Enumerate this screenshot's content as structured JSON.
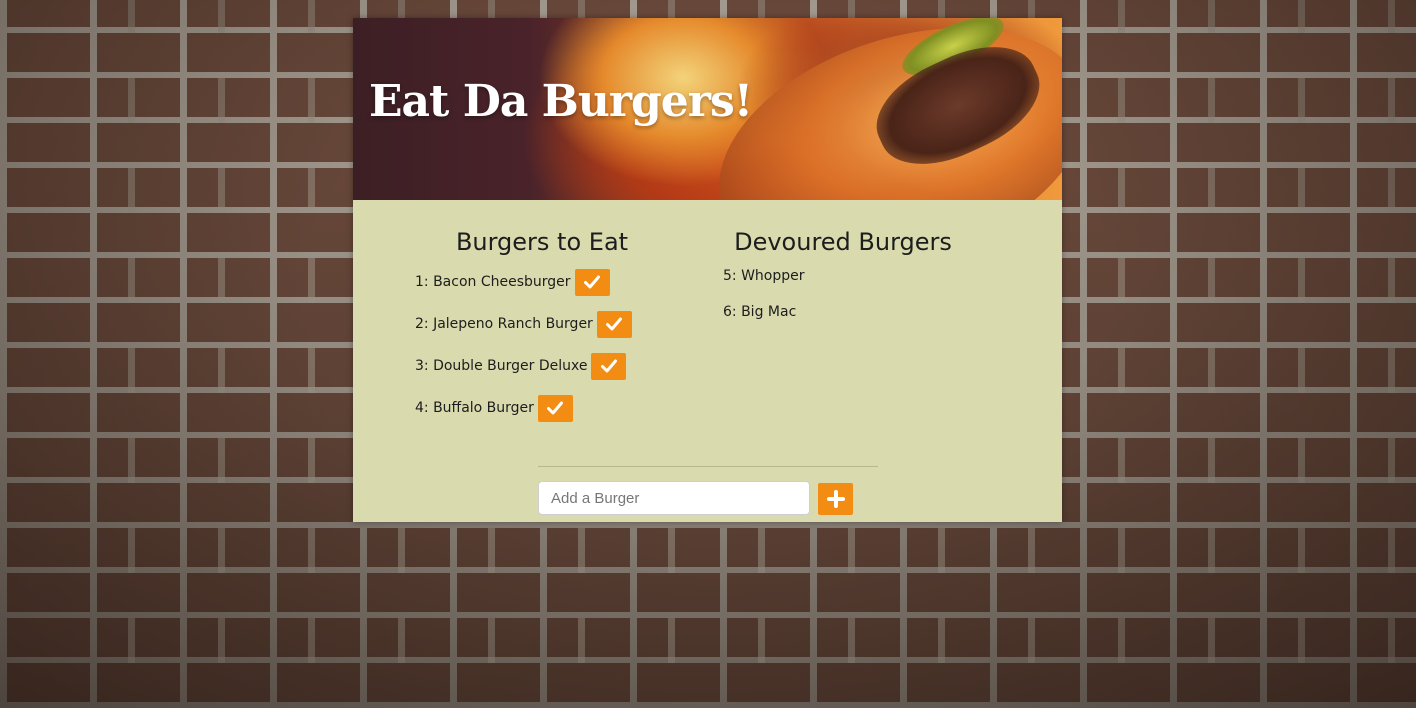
{
  "header": {
    "title": "Eat Da Burgers!"
  },
  "to_eat": {
    "heading": "Burgers to Eat",
    "items": [
      {
        "label": "1: Bacon Cheesburger"
      },
      {
        "label": "2: Jalepeno Ranch Burger"
      },
      {
        "label": "3: Double Burger Deluxe"
      },
      {
        "label": "4: Buffalo Burger"
      }
    ],
    "action_icon": "check-icon"
  },
  "devoured": {
    "heading": "Devoured Burgers",
    "items": [
      {
        "label": "5: Whopper"
      },
      {
        "label": "6: Big Mac"
      }
    ]
  },
  "form": {
    "placeholder": "Add a Burger",
    "submit_icon": "plus-icon"
  },
  "colors": {
    "accent": "#f28c12",
    "panel": "#d9dbae"
  }
}
